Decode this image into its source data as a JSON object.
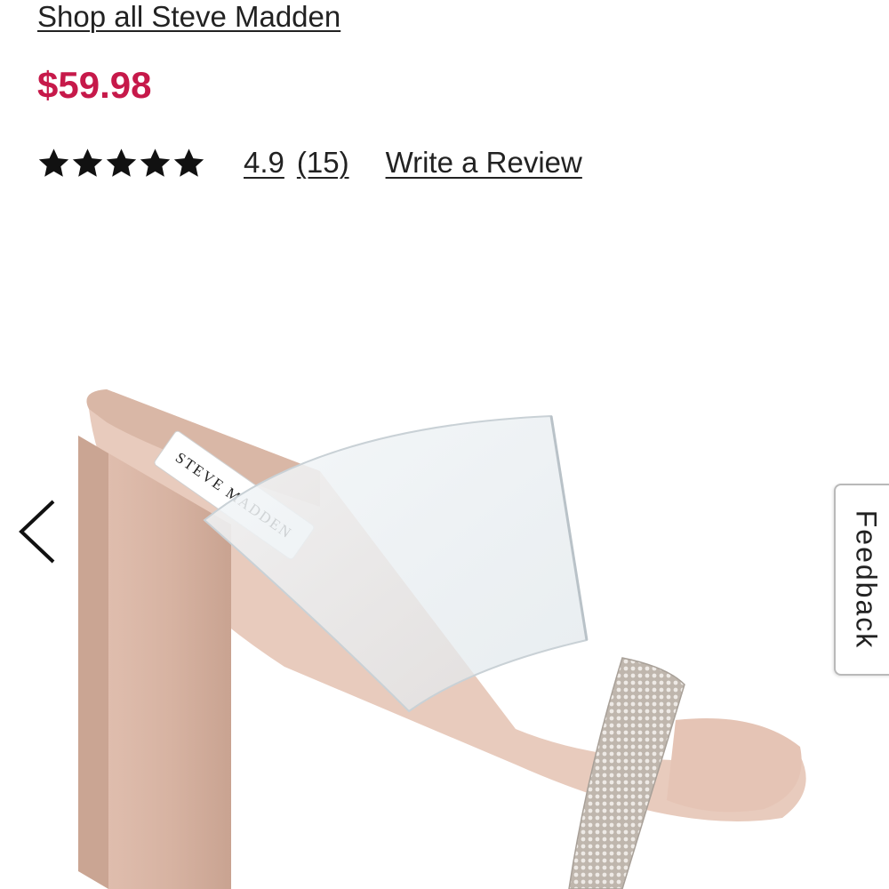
{
  "product": {
    "brand_link": "Shop all Steve Madden",
    "price": "$59.98",
    "rating": {
      "value": "4.9",
      "count": "(15)",
      "stars_filled": 5,
      "stars_total": 5
    },
    "write_review": "Write a Review",
    "label_text": "STEVE MADDEN"
  },
  "carousel": {
    "prev_icon": "chevron-left-icon"
  },
  "feedback": {
    "label": "Feedback"
  },
  "colors": {
    "price": "#c6194a",
    "text": "#222222",
    "heel": "#dcb8a8",
    "strap_clear": "#e9eef2"
  }
}
